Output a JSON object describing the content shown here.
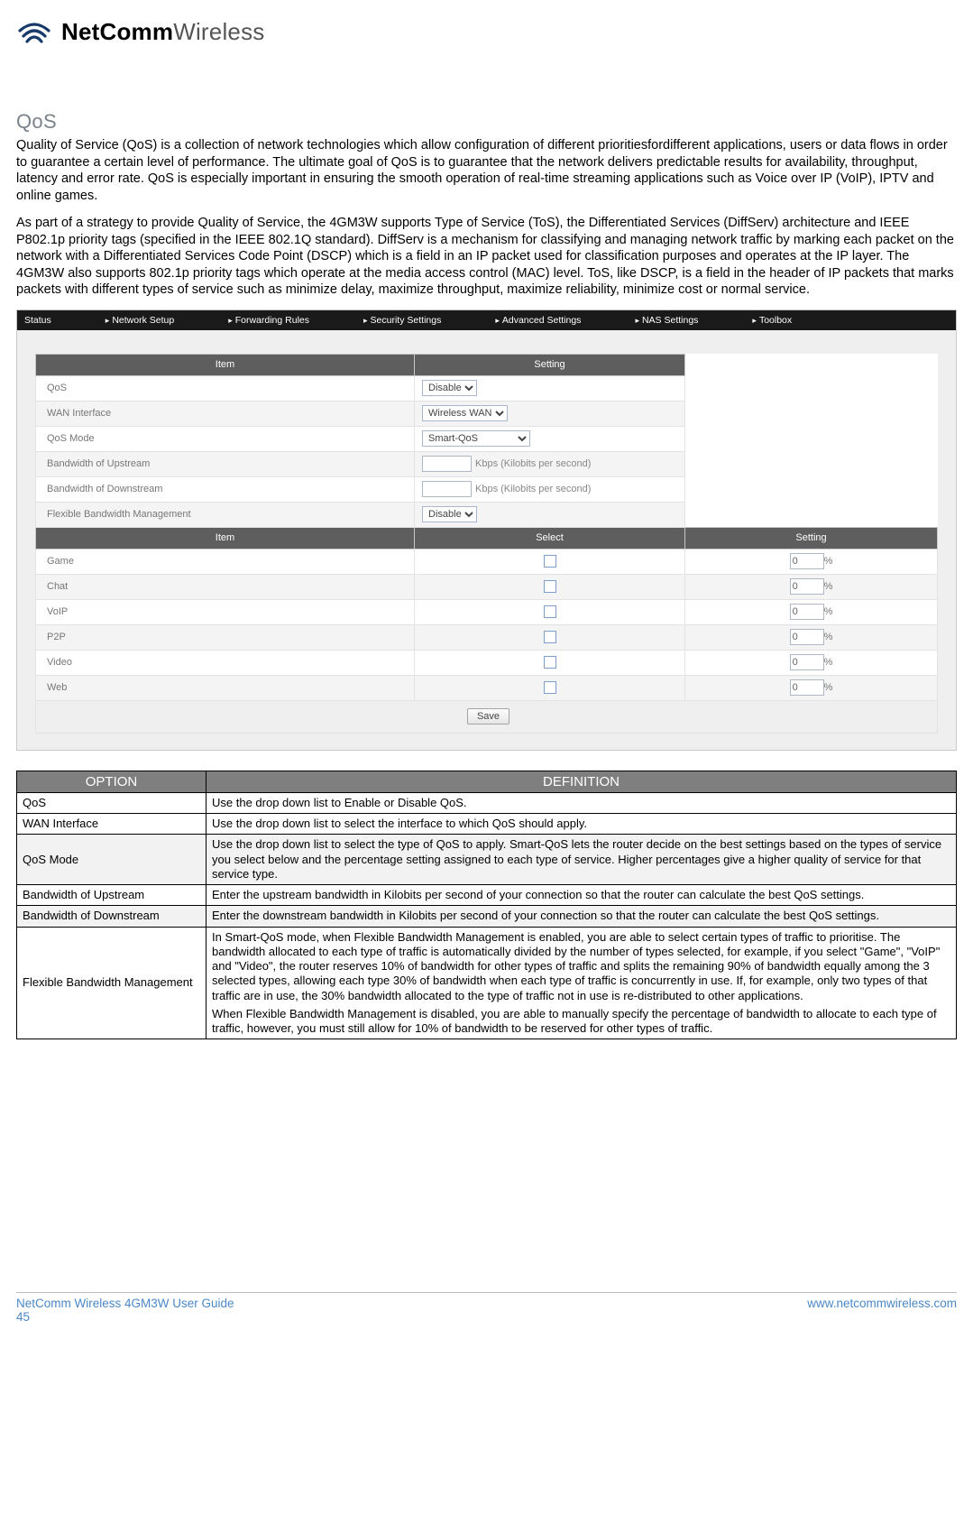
{
  "logo": {
    "bold": "NetComm",
    "light": "Wireless"
  },
  "title": "QoS",
  "para1": "Quality of Service (QoS) is a collection of network technologies which allow configuration of different prioritiesfordifferent applications, users or data flows in order to guarantee a certain level of performance. The ultimate goal of QoS is to guarantee that the network delivers predictable results for availability, throughput, latency and error rate. QoS is especially important in ensuring the smooth operation of real-time streaming applications such as Voice over IP (VoIP), IPTV and online games.",
  "para2": "As part of a strategy to provide Quality of Service, the 4GM3W supports Type of Service (ToS), the Differentiated Services (DiffServ) architecture and IEEE P802.1p priority tags (specified in the IEEE 802.1Q standard). DiffServ is a mechanism for classifying and managing network traffic by marking each packet on the network with a Differentiated Services Code Point (DSCP) which is a field in an IP packet used for classification purposes and operates at the IP layer. The 4GM3W also supports 802.1p priority tags which operate at the media access control (MAC) level. ToS, like DSCP, is a field in the header of IP packets that marks packets with different types of service such as minimize delay, maximize throughput, maximize reliability, minimize cost or normal service.",
  "nav": [
    "Status",
    "Network Setup",
    "Forwarding Rules",
    "Security Settings",
    "Advanced Settings",
    "NAS Settings",
    "Toolbox"
  ],
  "cfg_hdr": {
    "item": "Item",
    "setting": "Setting"
  },
  "cfg_rows": {
    "qos": {
      "label": "QoS",
      "value": "Disable"
    },
    "wan": {
      "label": "WAN Interface",
      "value": "Wireless WAN"
    },
    "mode": {
      "label": "QoS Mode",
      "value": "Smart-QoS"
    },
    "up": {
      "label": "Bandwidth of Upstream",
      "unit": "Kbps (Kilobits per second)"
    },
    "down": {
      "label": "Bandwidth of Downstream",
      "unit": "Kbps (Kilobits per second)"
    },
    "flex": {
      "label": "Flexible Bandwidth Management",
      "value": "Disable"
    }
  },
  "svc_hdr": {
    "item": "Item",
    "select": "Select",
    "setting": "Setting"
  },
  "services": [
    {
      "label": "Game",
      "pct": "0"
    },
    {
      "label": "Chat",
      "pct": "0"
    },
    {
      "label": "VoIP",
      "pct": "0"
    },
    {
      "label": "P2P",
      "pct": "0"
    },
    {
      "label": "Video",
      "pct": "0"
    },
    {
      "label": "Web",
      "pct": "0"
    }
  ],
  "pct_suffix": "%",
  "save_label": "Save",
  "def_hdr": {
    "option": "OPTION",
    "definition": "DEFINITION"
  },
  "defs": [
    {
      "opt": "QoS",
      "def": "Use the drop down list to Enable or Disable QoS."
    },
    {
      "opt": "WAN Interface",
      "def": "Use the drop down list to select the interface to which QoS should apply."
    },
    {
      "opt": "QoS Mode",
      "def": "Use the drop down list to select the type of QoS to apply. Smart-QoS lets the router decide on the best settings based on the types of service you select below and the percentage setting assigned to each type of service. Higher percentages give a higher quality of service for that service type."
    },
    {
      "opt": "Bandwidth of Upstream",
      "def": "Enter the upstream bandwidth in Kilobits per second of your connection so that the router can calculate the best QoS settings."
    },
    {
      "opt": "Bandwidth of Downstream",
      "def": "Enter the downstream bandwidth in Kilobits per second of your connection so that the router can calculate the best QoS settings."
    },
    {
      "opt": "Flexible Bandwidth Management",
      "def_a": "In Smart-QoS mode, when Flexible Bandwidth Management is enabled, you are able to select certain types of traffic to prioritise. The bandwidth allocated to each type of traffic is automatically divided by the number of types selected, for example, if you select \"Game\", \"VoIP\" and \"Video\", the router reserves 10% of bandwidth for other types of traffic and splits the remaining 90% of bandwidth equally among the 3 selected types, allowing each type 30% of bandwidth when each type of traffic is concurrently in use. If, for example, only two types of that traffic are in use, the 30% bandwidth allocated to the type of traffic not in use is re-distributed to other applications.",
      "def_b": "When Flexible Bandwidth Management is disabled, you are able to manually specify the percentage of bandwidth to allocate to each type of traffic, however, you must still allow for 10% of bandwidth to be reserved for other types of traffic."
    }
  ],
  "footer": {
    "left": "NetComm Wireless 4GM3W User Guide",
    "page": "45",
    "right": "www.netcommwireless.com"
  }
}
